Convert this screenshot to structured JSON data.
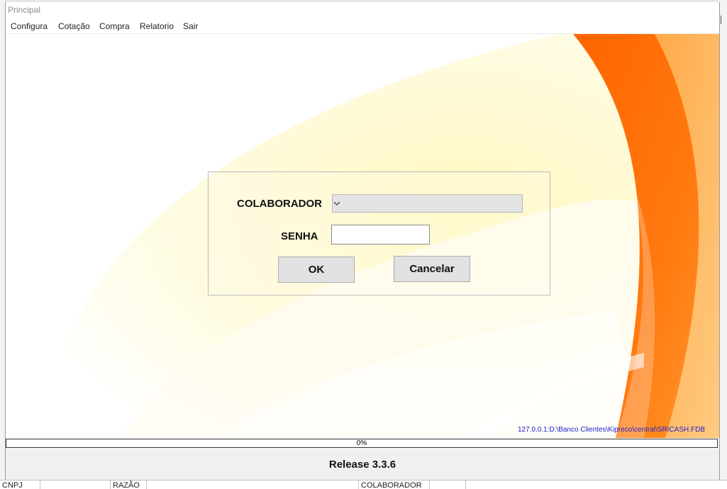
{
  "window": {
    "title": "Principal"
  },
  "menu": [
    {
      "label": "Configura"
    },
    {
      "label": "Cotação"
    },
    {
      "label": "Compra"
    },
    {
      "label": "Relatorio"
    },
    {
      "label": "Sair"
    }
  ],
  "login": {
    "colaborador_label": "COLABORADOR",
    "colaborador_value": "",
    "senha_label": "SENHA",
    "senha_value": "",
    "ok_label": "OK",
    "cancel_label": "Cancelar"
  },
  "database_path": "127.0.0.1:D:\\Banco Clientes\\Kipreco\\central\\SRICASH.FDB",
  "progress": {
    "value": 0,
    "text": "0%"
  },
  "release": "Release 3.3.6",
  "background_table_headers": [
    {
      "label": "CNPJ"
    },
    {
      "label": "RAZÃO"
    },
    {
      "label": "COLABORADOR"
    }
  ],
  "colors": {
    "orange_dark": "#ff6a00",
    "orange_light": "#ffa23c",
    "cream": "#fff7c8",
    "link_blue": "#2222cc"
  }
}
